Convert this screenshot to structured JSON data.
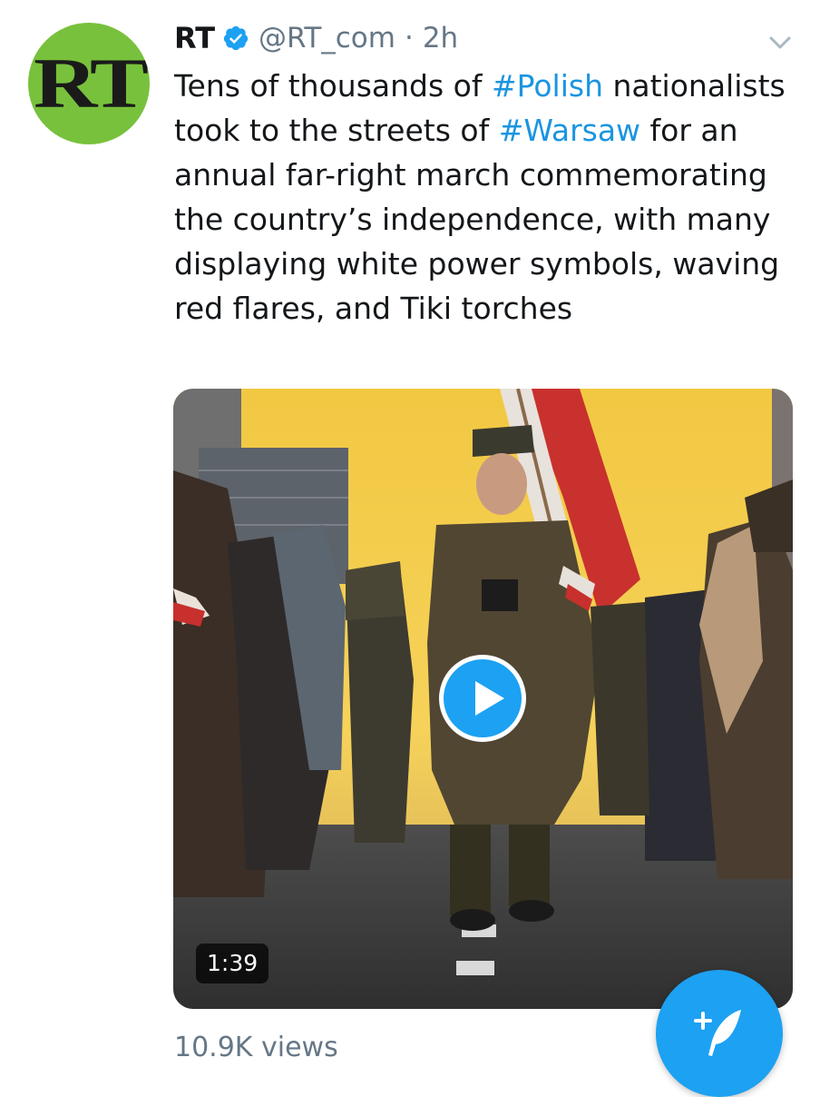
{
  "tweet": {
    "avatar_text": "RT",
    "display_name": "RT",
    "handle": "@RT_com",
    "separator": "·",
    "timestamp": "2h",
    "text_parts": [
      {
        "text": "Tens of thousands of ",
        "type": "text"
      },
      {
        "text": "#Polish",
        "type": "hashtag"
      },
      {
        "text": " nationalists took to the streets of ",
        "type": "text"
      },
      {
        "text": "#Warsaw",
        "type": "hashtag"
      },
      {
        "text": " for an annual far-right march commemorating the country’s independence, with many displaying white power symbols, waving red flares, and Tiki torches",
        "type": "text"
      }
    ],
    "video": {
      "duration": "1:39"
    },
    "views": "10.9K views"
  },
  "icons": {
    "verified": "verified-badge-icon",
    "caret": "chevron-down-icon",
    "play": "play-icon",
    "compose": "compose-tweet-icon"
  },
  "colors": {
    "link": "#1b95e0",
    "accent": "#1da1f2",
    "secondary_text": "#657786",
    "avatar_bg": "#78c13c"
  }
}
